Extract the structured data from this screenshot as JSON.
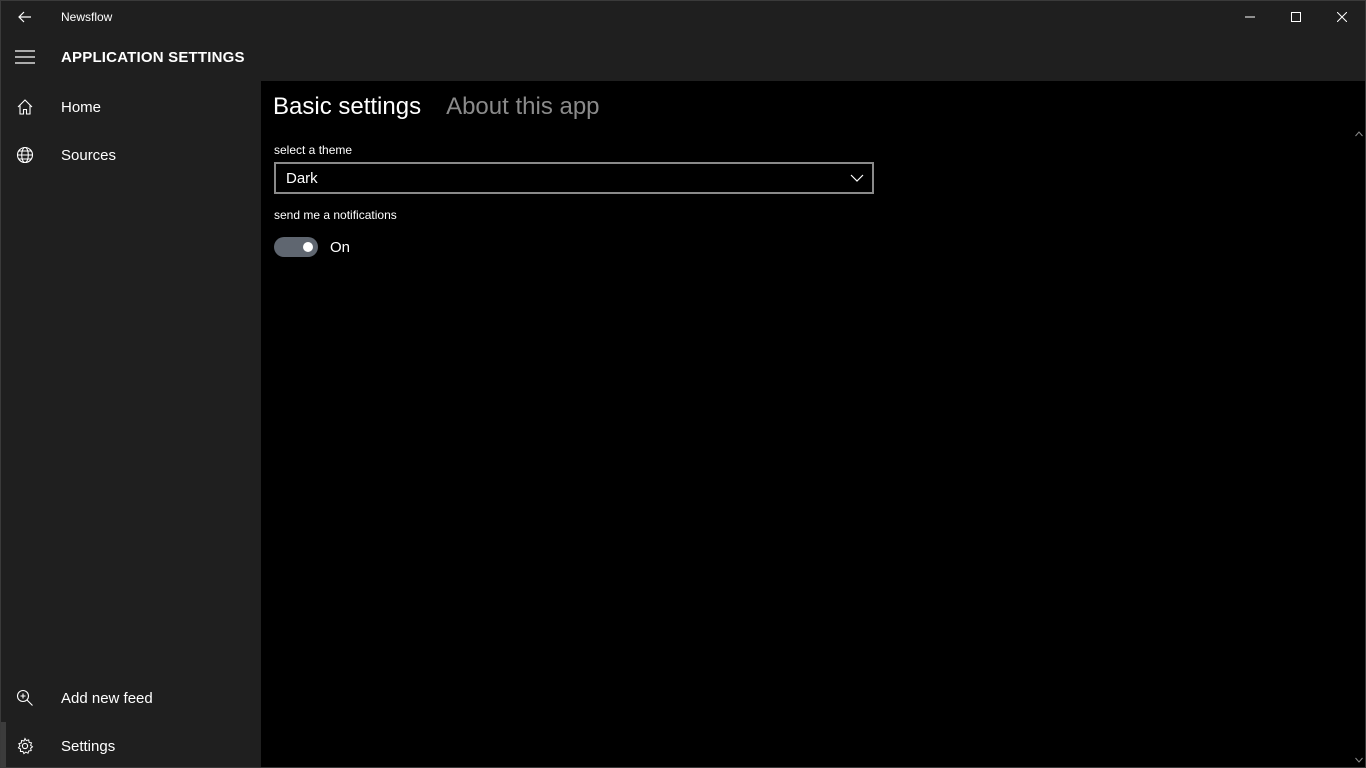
{
  "window": {
    "title": "Newsflow",
    "icons": {
      "back": "back-arrow-icon",
      "minimize": "minimize-icon",
      "maximize": "maximize-icon",
      "close": "close-icon"
    }
  },
  "header": {
    "title": "APPLICATION SETTINGS",
    "menu_icon": "hamburger-icon"
  },
  "sidebar": {
    "items": [
      {
        "label": "Home",
        "icon": "home-icon"
      },
      {
        "label": "Sources",
        "icon": "globe-icon"
      }
    ],
    "bottom_items": [
      {
        "label": "Add new feed",
        "icon": "zoom-add-icon"
      },
      {
        "label": "Settings",
        "icon": "gear-icon",
        "selected": true
      }
    ]
  },
  "content": {
    "tabs": [
      {
        "label": "Basic settings",
        "active": true
      },
      {
        "label": "About this app",
        "active": false
      }
    ],
    "theme": {
      "label": "select a theme",
      "value": "Dark"
    },
    "notifications": {
      "label": "send me a notifications",
      "state_text": "On",
      "enabled": true
    }
  },
  "colors": {
    "chrome": "#1f1f1f",
    "background": "#000000",
    "inactive_text": "#8a8a8a",
    "toggle_track": "#5f6670"
  }
}
